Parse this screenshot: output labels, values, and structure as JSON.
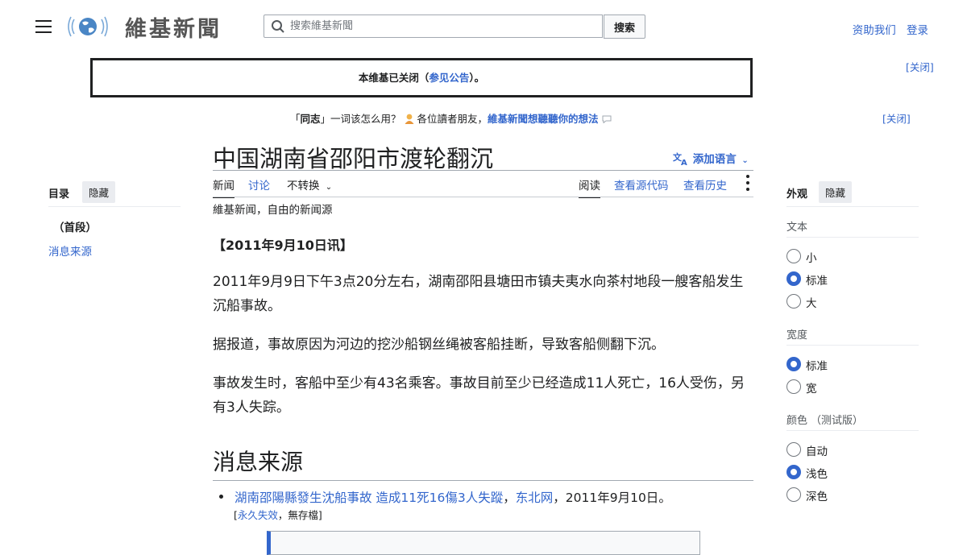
{
  "header": {
    "wordmark": "維基新聞",
    "search_placeholder": "搜索維基新聞",
    "search_button": "搜索",
    "donate": "资助我们",
    "login": "登录"
  },
  "notices": {
    "closure_before": "本维基已关闭（",
    "closure_link": "参见公告",
    "closure_after": "）。",
    "close_label": "[关闭]",
    "survey_prefix": "「",
    "survey_tongzhi": "同志",
    "survey_middle": "」一词该怎么用？",
    "survey_friends": "各位讀者朋友，",
    "survey_link": "維基新聞想聽聽你的想法",
    "survey_icon": "speech-bubble-icon"
  },
  "article": {
    "title": "中国湖南省邵阳市渡轮翻沉",
    "add_language": "添加语言",
    "tabs_left": [
      "新闻",
      "讨论",
      "不转换"
    ],
    "tabs_right": [
      "阅读",
      "查看源代码",
      "查看历史"
    ],
    "tagline": "維基新闻，自由的新闻源",
    "date": "【2011年9月10日讯】",
    "paragraphs": [
      "2011年9月9日下午3点20分左右，湖南邵阳县塘田市镇夫夷水向茶村地段一艘客船发生沉船事故。",
      "据报道，事故原因为河边的挖沙船钢丝绳被客船挂断，导致客船侧翻下沉。",
      "事故发生时，客船中至少有43名乘客。事故目前至少已经造成11人死亡，16人受伤，另有3人失踪。"
    ],
    "section_heading": "消息来源",
    "source": {
      "link": "湖南邵陽縣發生沈船事故 造成11死16傷3人失蹤",
      "sep": "，",
      "publisher": "东北网",
      "date_text": "，2011年9月10日。",
      "sub_open": "[",
      "sub_link": "永久失效",
      "sub_rest": "，無存檔]"
    }
  },
  "toc": {
    "title": "目录",
    "hide": "隐藏",
    "items": [
      "（首段）",
      "消息来源"
    ]
  },
  "appearance": {
    "title": "外观",
    "hide": "隐藏",
    "text_label": "文本",
    "text_options": [
      "小",
      "标准",
      "大"
    ],
    "text_selected": "标准",
    "width_label": "宽度",
    "width_options": [
      "标准",
      "宽"
    ],
    "width_selected": "标准",
    "color_label": "颜色",
    "color_beta": "（测试版）",
    "color_options": [
      "自动",
      "浅色",
      "深色"
    ],
    "color_selected": "浅色"
  },
  "colors": {
    "link": "#3366cc",
    "radio_on": "#3366cc",
    "text": "#202122"
  }
}
